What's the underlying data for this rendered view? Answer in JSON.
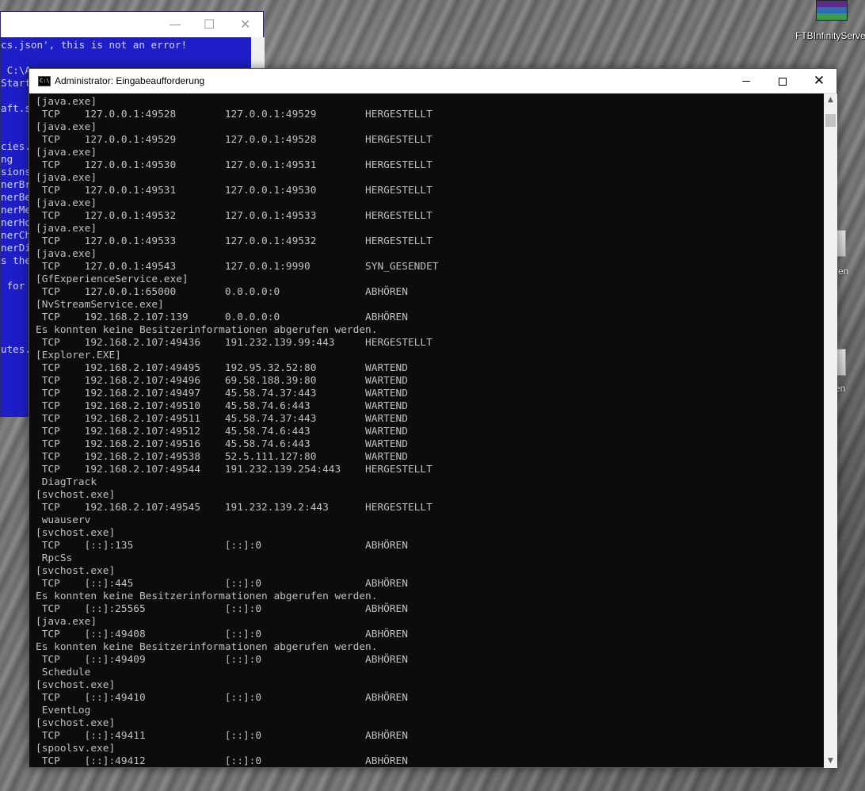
{
  "desktop": {
    "icon_label": "FTBInfinityServer",
    "side_labels": [
      "ren",
      "en"
    ]
  },
  "bg_window": {
    "lines": [
      "cs.json', this is not an error!",
      "",
      " C:\\A",
      "Start",
      "",
      "aft.s",
      "",
      "",
      "cies.",
      "ng",
      "sions",
      "nerBr",
      "nerBe",
      "nerMe",
      "nerHo",
      "nerCh",
      "nerDi",
      "s the",
      "",
      " for",
      "",
      "",
      "",
      "",
      "utes."
    ]
  },
  "cmd_window": {
    "title": "Administrator: Eingabeaufforderung",
    "icon_text": "C:\\",
    "lines": [
      "[java.exe]",
      " TCP    127.0.0.1:49528        127.0.0.1:49529        HERGESTELLT",
      "[java.exe]",
      " TCP    127.0.0.1:49529        127.0.0.1:49528        HERGESTELLT",
      "[java.exe]",
      " TCP    127.0.0.1:49530        127.0.0.1:49531        HERGESTELLT",
      "[java.exe]",
      " TCP    127.0.0.1:49531        127.0.0.1:49530        HERGESTELLT",
      "[java.exe]",
      " TCP    127.0.0.1:49532        127.0.0.1:49533        HERGESTELLT",
      "[java.exe]",
      " TCP    127.0.0.1:49533        127.0.0.1:49532        HERGESTELLT",
      "[java.exe]",
      " TCP    127.0.0.1:49543        127.0.0.1:9990         SYN_GESENDET",
      "[GfExperienceService.exe]",
      " TCP    127.0.0.1:65000        0.0.0.0:0              ABHÖREN",
      "[NvStreamService.exe]",
      " TCP    192.168.2.107:139      0.0.0.0:0              ABHÖREN",
      "Es konnten keine Besitzerinformationen abgerufen werden.",
      " TCP    192.168.2.107:49436    191.232.139.99:443     HERGESTELLT",
      "[Explorer.EXE]",
      " TCP    192.168.2.107:49495    192.95.32.52:80        WARTEND",
      " TCP    192.168.2.107:49496    69.58.188.39:80        WARTEND",
      " TCP    192.168.2.107:49497    45.58.74.37:443        WARTEND",
      " TCP    192.168.2.107:49510    45.58.74.6:443         WARTEND",
      " TCP    192.168.2.107:49511    45.58.74.37:443        WARTEND",
      " TCP    192.168.2.107:49512    45.58.74.6:443         WARTEND",
      " TCP    192.168.2.107:49516    45.58.74.6:443         WARTEND",
      " TCP    192.168.2.107:49538    52.5.111.127:80        WARTEND",
      " TCP    192.168.2.107:49544    191.232.139.254:443    HERGESTELLT",
      " DiagTrack",
      "[svchost.exe]",
      " TCP    192.168.2.107:49545    191.232.139.2:443      HERGESTELLT",
      " wuauserv",
      "[svchost.exe]",
      " TCP    [::]:135               [::]:0                 ABHÖREN",
      " RpcSs",
      "[svchost.exe]",
      " TCP    [::]:445               [::]:0                 ABHÖREN",
      "Es konnten keine Besitzerinformationen abgerufen werden.",
      " TCP    [::]:25565             [::]:0                 ABHÖREN",
      "[java.exe]",
      " TCP    [::]:49408             [::]:0                 ABHÖREN",
      "Es konnten keine Besitzerinformationen abgerufen werden.",
      " TCP    [::]:49409             [::]:0                 ABHÖREN",
      " Schedule",
      "[svchost.exe]",
      " TCP    [::]:49410             [::]:0                 ABHÖREN",
      " EventLog",
      "[svchost.exe]",
      " TCP    [::]:49411             [::]:0                 ABHÖREN",
      "[spoolsv.exe]",
      " TCP    [::]:49412             [::]:0                 ABHÖREN"
    ]
  },
  "colors": {
    "console_bg": "#0c0c0c",
    "console_text": "#c0c0c0",
    "bg_console": "#1e1ec8"
  },
  "icons": {
    "minimize": "minimize-icon",
    "maximize": "maximize-icon",
    "close": "close-icon",
    "scroll_up": "arrow-up-icon",
    "scroll_down": "arrow-down-icon"
  }
}
